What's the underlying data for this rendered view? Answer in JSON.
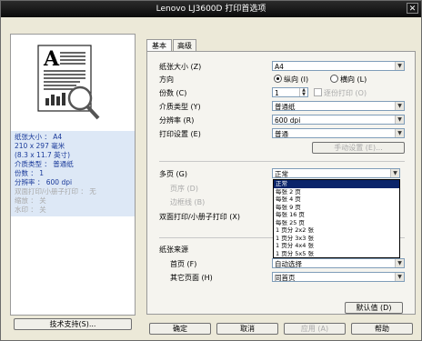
{
  "window": {
    "title": "Lenovo LJ3600D 打印首选项",
    "close": "✕"
  },
  "info": {
    "line1": "纸张大小 ： A4",
    "line2": "210 x 297 毫米",
    "line3": "(8.3 x 11.7 英寸)",
    "line4": "介质类型 ： 普通纸",
    "line5": "份数 ： 1",
    "line6": "分辨率 ： 600 dpi",
    "line7": "双面打印/小册子打印 ： 无",
    "line8": "缩放 ： 关",
    "line9": "水印 ： 关"
  },
  "support_button": "技术支持(S)...",
  "tabs": [
    {
      "label": "基本"
    },
    {
      "label": "高级"
    }
  ],
  "form": {
    "paper_size_label": "纸张大小 (Z)",
    "paper_size_value": "A4",
    "orientation_label": "方向",
    "orientation_portrait": "纵向 (I)",
    "orientation_landscape": "横向 (L)",
    "copies_label": "份数 (C)",
    "copies_value": "1",
    "collate_label": "逐份打印 (O)",
    "media_type_label": "介质类型 (Y)",
    "media_type_value": "普通纸",
    "resolution_label": "分辨率 (R)",
    "resolution_value": "600 dpi",
    "print_settings_label": "打印设置 (E)",
    "print_settings_value": "普通",
    "manual_settings_button": "手动设置 (E)...",
    "multipage_label": "多页 (G)",
    "multipage_value": "正常",
    "page_order_label": "页序 (D)",
    "border_line_label": "边框线 (B)",
    "duplex_label": "双面打印/小册子打印 (X)",
    "paper_source_label": "纸张来源",
    "first_page_label": "首页 (F)",
    "first_page_value": "自动选择",
    "other_pages_label": "其它页面 (H)",
    "other_pages_value": "同首页",
    "default_button": "默认值 (D)"
  },
  "multipage_options": [
    "正常",
    "每张 2 页",
    "每张 4 页",
    "每张 9 页",
    "每张 16 页",
    "每张 25 页",
    "1 页分 2x2 张",
    "1 页分 3x3 张",
    "1 页分 4x4 张",
    "1 页分 5x5 张"
  ],
  "bottom_buttons": {
    "ok": "确定",
    "cancel": "取消",
    "apply": "应用 (A)",
    "help": "帮助"
  }
}
